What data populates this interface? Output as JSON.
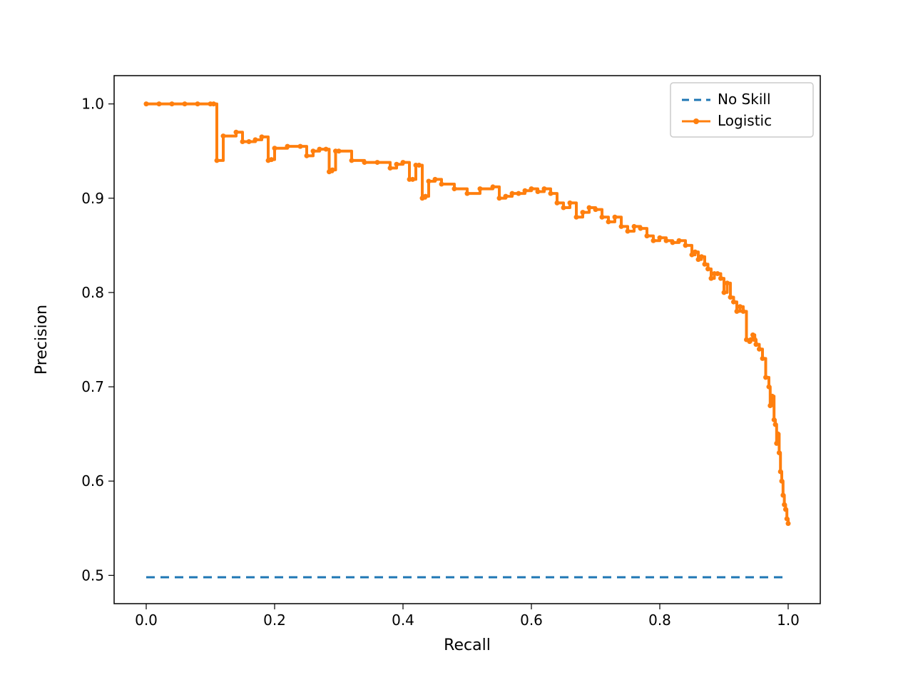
{
  "chart_data": {
    "type": "line",
    "xlabel": "Recall",
    "ylabel": "Precision",
    "xlim": [
      -0.05,
      1.05
    ],
    "ylim": [
      0.47,
      1.03
    ],
    "xticks": [
      0.0,
      0.2,
      0.4,
      0.6,
      0.8,
      1.0
    ],
    "yticks": [
      0.5,
      0.6,
      0.7,
      0.8,
      0.9,
      1.0
    ],
    "series": [
      {
        "name": "No Skill",
        "style": "dashed",
        "color": "#1f77b4",
        "x": [
          0,
          1
        ],
        "y": [
          0.498,
          0.498
        ]
      },
      {
        "name": "Logistic",
        "style": "line-marker",
        "color": "#ff7f0e",
        "x": [
          0.0,
          0.02,
          0.04,
          0.06,
          0.08,
          0.1,
          0.105,
          0.11,
          0.12,
          0.14,
          0.15,
          0.16,
          0.17,
          0.18,
          0.19,
          0.195,
          0.2,
          0.22,
          0.24,
          0.25,
          0.26,
          0.27,
          0.28,
          0.285,
          0.29,
          0.295,
          0.3,
          0.32,
          0.34,
          0.36,
          0.38,
          0.39,
          0.4,
          0.41,
          0.415,
          0.42,
          0.425,
          0.43,
          0.435,
          0.44,
          0.45,
          0.46,
          0.48,
          0.5,
          0.52,
          0.54,
          0.55,
          0.56,
          0.57,
          0.58,
          0.59,
          0.6,
          0.61,
          0.62,
          0.63,
          0.64,
          0.65,
          0.66,
          0.67,
          0.68,
          0.69,
          0.7,
          0.71,
          0.72,
          0.73,
          0.74,
          0.75,
          0.76,
          0.77,
          0.78,
          0.79,
          0.8,
          0.81,
          0.82,
          0.83,
          0.84,
          0.85,
          0.855,
          0.86,
          0.865,
          0.87,
          0.875,
          0.88,
          0.885,
          0.89,
          0.895,
          0.9,
          0.905,
          0.91,
          0.915,
          0.92,
          0.925,
          0.93,
          0.935,
          0.94,
          0.942,
          0.945,
          0.948,
          0.95,
          0.955,
          0.96,
          0.965,
          0.97,
          0.972,
          0.975,
          0.978,
          0.98,
          0.982,
          0.984,
          0.986,
          0.988,
          0.99,
          0.992,
          0.994,
          0.996,
          0.998,
          1.0
        ],
        "y": [
          1.0,
          1.0,
          1.0,
          1.0,
          1.0,
          1.0,
          1.0,
          0.94,
          0.966,
          0.97,
          0.96,
          0.96,
          0.962,
          0.965,
          0.94,
          0.941,
          0.953,
          0.955,
          0.955,
          0.945,
          0.95,
          0.952,
          0.952,
          0.928,
          0.93,
          0.95,
          0.95,
          0.94,
          0.938,
          0.938,
          0.932,
          0.936,
          0.938,
          0.92,
          0.92,
          0.935,
          0.935,
          0.9,
          0.902,
          0.918,
          0.92,
          0.915,
          0.91,
          0.905,
          0.91,
          0.912,
          0.9,
          0.902,
          0.905,
          0.905,
          0.908,
          0.91,
          0.907,
          0.91,
          0.905,
          0.895,
          0.89,
          0.895,
          0.88,
          0.885,
          0.89,
          0.888,
          0.88,
          0.875,
          0.88,
          0.87,
          0.865,
          0.87,
          0.868,
          0.86,
          0.855,
          0.858,
          0.855,
          0.853,
          0.855,
          0.85,
          0.84,
          0.843,
          0.835,
          0.838,
          0.83,
          0.825,
          0.815,
          0.82,
          0.82,
          0.815,
          0.8,
          0.81,
          0.795,
          0.79,
          0.78,
          0.785,
          0.78,
          0.75,
          0.748,
          0.75,
          0.755,
          0.75,
          0.745,
          0.74,
          0.73,
          0.71,
          0.7,
          0.68,
          0.69,
          0.665,
          0.66,
          0.64,
          0.65,
          0.63,
          0.61,
          0.6,
          0.585,
          0.575,
          0.57,
          0.56,
          0.555
        ]
      }
    ],
    "legend": {
      "entries": [
        "No Skill",
        "Logistic"
      ],
      "position": "upper right"
    }
  }
}
